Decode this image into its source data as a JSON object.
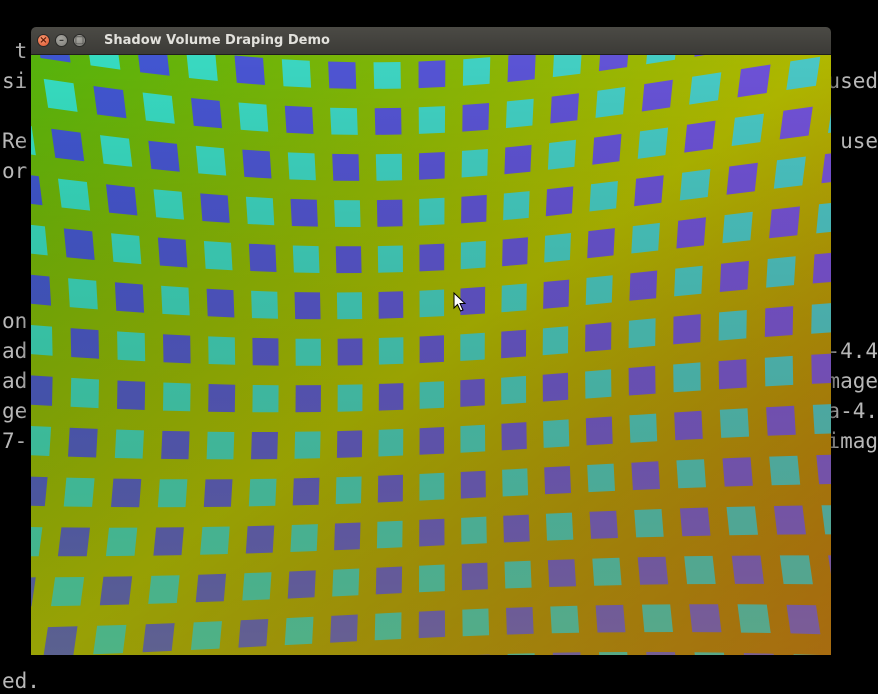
{
  "terminal": {
    "left_fragments": [
      {
        "text": " t",
        "row": 1
      },
      {
        "text": "si",
        "row": 2
      },
      {
        "text": "Re",
        "row": 4
      },
      {
        "text": "or",
        "row": 5
      },
      {
        "text": "on",
        "row": 10
      },
      {
        "text": "ad",
        "row": 11
      },
      {
        "text": "ad",
        "row": 12
      },
      {
        "text": "ge",
        "row": 13
      },
      {
        "text": "7-",
        "row": 14
      },
      {
        "text": "ed.",
        "row": 22
      }
    ],
    "right_fragments": [
      {
        "text": "used",
        "row": 2
      },
      {
        "text": "use",
        "row": 4
      },
      {
        "text": "-4.4",
        "row": 11
      },
      {
        "text": "image",
        "row": 12
      },
      {
        "text": "a-4.",
        "row": 13
      },
      {
        "text": "imag",
        "row": 14
      }
    ]
  },
  "window": {
    "title": "Shadow Volume Draping Demo",
    "close_glyph": "×",
    "minimize_glyph": "–",
    "maximize_glyph": "□"
  },
  "scene": {
    "grid_colors": {
      "green": "#55b30c",
      "yellow": "#b0b800",
      "orange": "#c86410",
      "olive": "#6a7a10",
      "tile_cyan": "#36dcc0",
      "tile_blue": "#3e56d0",
      "tile_violet": "#8a50dc"
    }
  }
}
